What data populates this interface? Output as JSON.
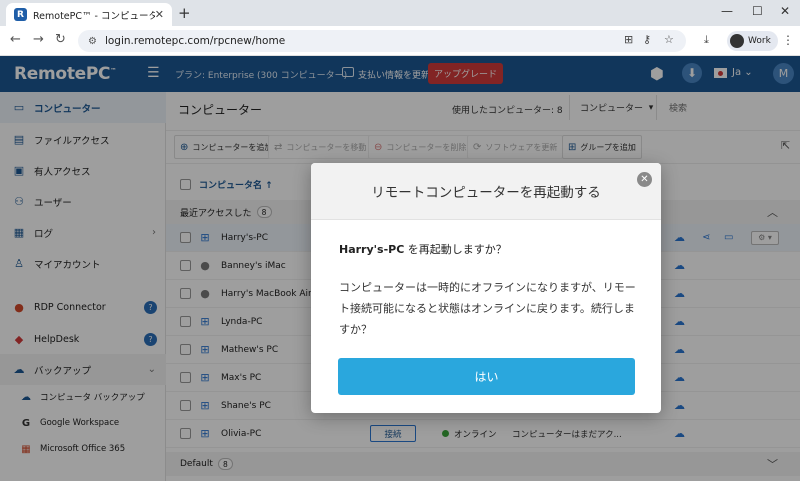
{
  "browser": {
    "tab_title": "RemotePC™ - コンピューター",
    "url": "login.remotepc.com/rpcnew/home",
    "profile": "Work"
  },
  "header": {
    "logo": "RemotePC",
    "logo_tm": "™",
    "plan": "プラン: Enterprise (300 コンピューター)",
    "pay": "支払い情報を更新",
    "upgrade": "アップグレード",
    "lang": "Ja",
    "avatar": "M"
  },
  "sidebar": {
    "items": [
      {
        "label": "コンピューター"
      },
      {
        "label": "ファイルアクセス"
      },
      {
        "label": "有人アクセス"
      },
      {
        "label": "ユーザー"
      },
      {
        "label": "ログ"
      },
      {
        "label": "マイアカウント"
      },
      {
        "label": "RDP Connector"
      },
      {
        "label": "HelpDesk"
      },
      {
        "label": "バックアップ"
      }
    ],
    "sub": [
      {
        "label": "コンピュータ バックアップ"
      },
      {
        "label": "Google Workspace"
      },
      {
        "label": "Microsoft Office 365"
      }
    ]
  },
  "main": {
    "title": "コンピューター",
    "used": "使用したコンピューター: 8",
    "filter": "コンピューター",
    "search_placeholder": "検索",
    "toolbar": {
      "add": "コンピューターを追加",
      "move": "コンピューターを移動",
      "delete": "コンピューターを削除",
      "update": "ソフトウェアを更新",
      "group": "グループを追加"
    },
    "col_name": "コンピュータ名 ↑",
    "group_recent": "最近アクセスした",
    "group_recent_count": "8",
    "group_default": "Default",
    "group_default_count": "8",
    "rows": [
      {
        "name": "Harry's-PC"
      },
      {
        "name": "Banney's iMac"
      },
      {
        "name": "Harry's MacBook Air"
      },
      {
        "name": "Lynda-PC"
      },
      {
        "name": "Mathew's PC"
      },
      {
        "name": "Max's PC"
      },
      {
        "name": "Shane's PC"
      },
      {
        "name": "Olivia-PC"
      }
    ],
    "connect": "接続",
    "online": "オンライン",
    "note": "コンピューターはまだアク..."
  },
  "modal": {
    "title": "リモートコンピューターを再起動する",
    "q_name": "Harry's-PC",
    "q_text": " を再起動しますか？",
    "body": "コンピューターは一時的にオフラインになりますが、リモート接続可能になると状態はオンラインに戻ります。続行しますか？",
    "confirm": "はい"
  }
}
